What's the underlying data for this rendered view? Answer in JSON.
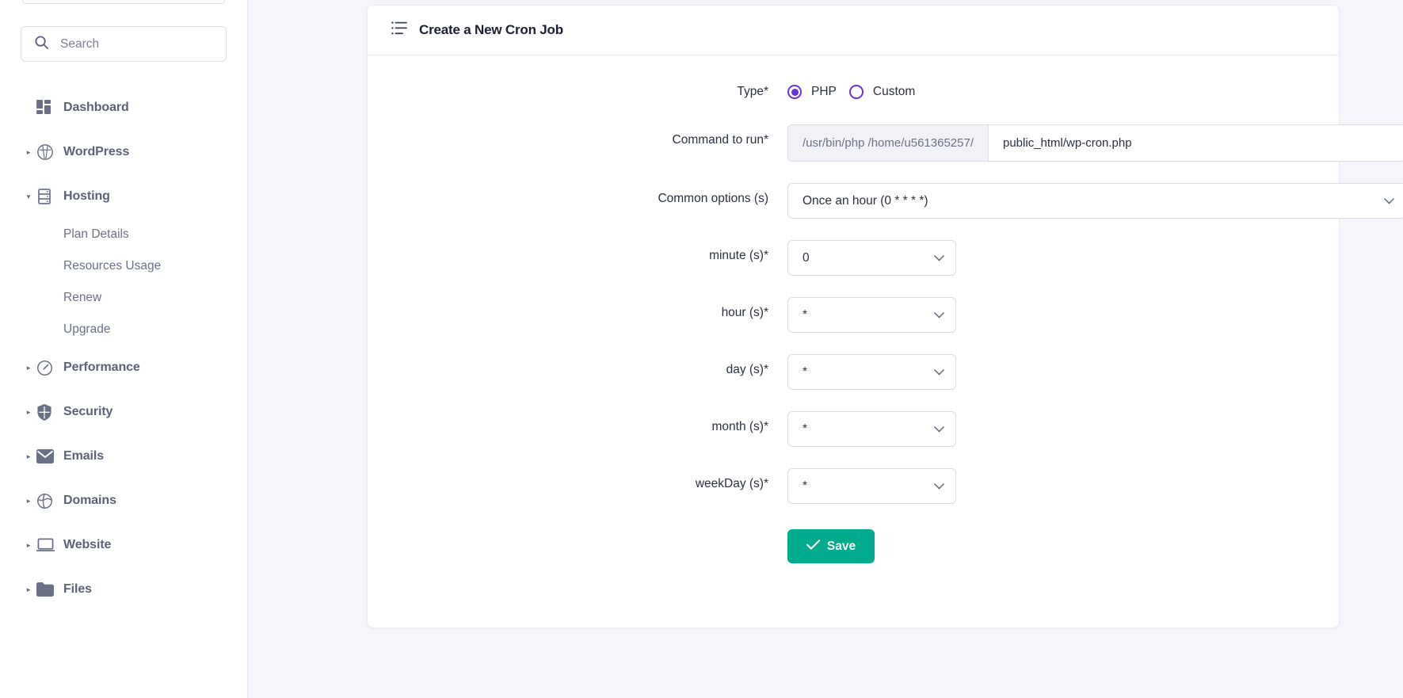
{
  "sidebar": {
    "search": {
      "placeholder": "Search",
      "value": "",
      "icon": "search-icon"
    },
    "items": [
      {
        "label": "Dashboard",
        "icon": "dashboard-icon",
        "caret": "",
        "expanded": false
      },
      {
        "label": "WordPress",
        "icon": "wordpress-icon",
        "caret": "▸",
        "expanded": false
      },
      {
        "label": "Hosting",
        "icon": "hosting-icon",
        "caret": "▾",
        "expanded": true
      },
      {
        "label": "Performance",
        "icon": "performance-gauge-icon",
        "caret": "▸",
        "expanded": false
      },
      {
        "label": "Security",
        "icon": "shield-icon",
        "caret": "▸",
        "expanded": false
      },
      {
        "label": "Emails",
        "icon": "envelope-icon",
        "caret": "▸",
        "expanded": false
      },
      {
        "label": "Domains",
        "icon": "globe-icon",
        "caret": "▸",
        "expanded": false
      },
      {
        "label": "Website",
        "icon": "laptop-icon",
        "caret": "▸",
        "expanded": false
      },
      {
        "label": "Files",
        "icon": "folder-icon",
        "caret": "▸",
        "expanded": false
      }
    ],
    "hosting_subitems": [
      {
        "label": "Plan Details"
      },
      {
        "label": "Resources Usage"
      },
      {
        "label": "Renew"
      },
      {
        "label": "Upgrade"
      }
    ]
  },
  "card": {
    "title": "Create a New Cron Job",
    "title_icon": "list-lines-icon",
    "form": {
      "type": {
        "label": "Type*",
        "options": [
          {
            "label": "PHP",
            "selected": true
          },
          {
            "label": "Custom",
            "selected": false
          }
        ],
        "accent_color": "#6b30e0"
      },
      "command": {
        "label": "Command to run*",
        "prefix": "/usr/bin/php /home/u561365257/",
        "value": "public_html/wp-cron.php",
        "placeholder": ""
      },
      "common_options": {
        "label": "Common options (s)",
        "value": "Once an hour (0 * * * *)"
      },
      "minute": {
        "label": "minute (s)*",
        "value": "0"
      },
      "hour": {
        "label": "hour (s)*",
        "value": "*"
      },
      "day": {
        "label": "day (s)*",
        "value": "*"
      },
      "month": {
        "label": "month (s)*",
        "value": "*"
      },
      "weekday": {
        "label": "weekDay (s)*",
        "value": "*"
      },
      "save": {
        "label": "Save",
        "icon": "check-icon",
        "color": "#00ab8e"
      }
    }
  }
}
